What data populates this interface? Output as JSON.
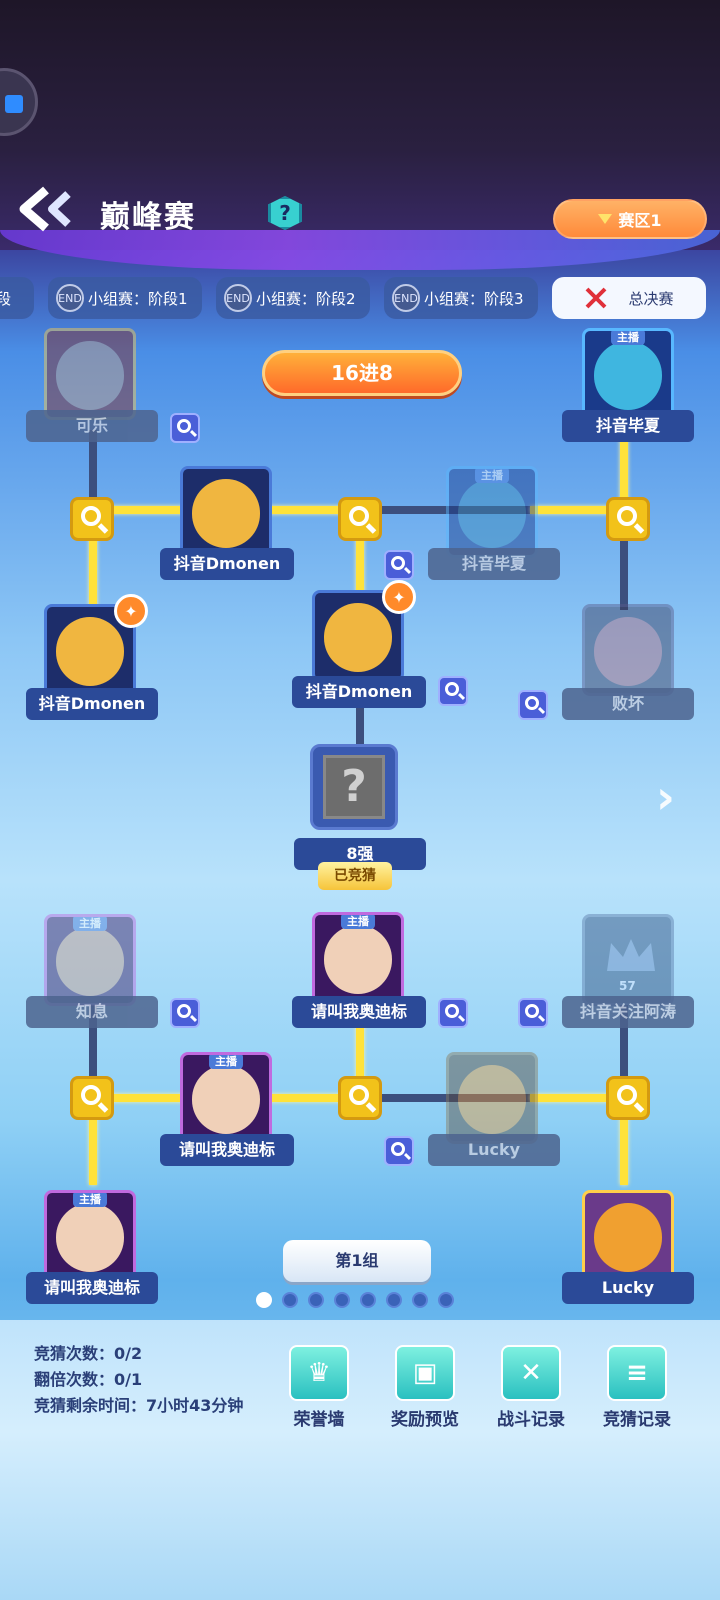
{
  "header": {
    "title": "巅峰赛",
    "help": "?",
    "region_label": "赛区1"
  },
  "tabs": [
    {
      "end": "",
      "label": "段"
    },
    {
      "end": "END",
      "label": "小组赛：阶段1"
    },
    {
      "end": "END",
      "label": "小组赛：阶段2"
    },
    {
      "end": "END",
      "label": "小组赛：阶段3"
    },
    {
      "label": "总决赛"
    }
  ],
  "stage_label": "16进8",
  "tag_label": "主播",
  "players": {
    "p1": "可乐",
    "p2": "抖音毕夏",
    "p3": "抖音Dmonen",
    "p4": "抖音毕夏",
    "p5": "抖音Dmonen",
    "p6": "抖音Dmonen",
    "p7": "败坏",
    "p8": "知息",
    "p9": "请叫我奥迪标",
    "p10": "抖音关注阿涛",
    "p11": "请叫我奥迪标",
    "p12": "Lucky",
    "p13": "请叫我奥迪标",
    "p14": "Lucky"
  },
  "crown_level": "57",
  "mystery": {
    "symbol": "?",
    "label": "8强"
  },
  "guessed_label": "已竞猜",
  "group_label": "第1组",
  "pagination": {
    "total": 8,
    "current": 1
  },
  "stats": {
    "guess_count": "竞猜次数：0/2",
    "double_count": "翻倍次数：0/1",
    "time_left": "竞猜剩余时间：7小时43分钟"
  },
  "footer_buttons": [
    "荣誉墙",
    "奖励预览",
    "战斗记录",
    "竞猜记录"
  ],
  "colors": {
    "accent": "#ffe23a",
    "card_bg": "#2b4a98",
    "region_btn": "#ff8a3a"
  }
}
